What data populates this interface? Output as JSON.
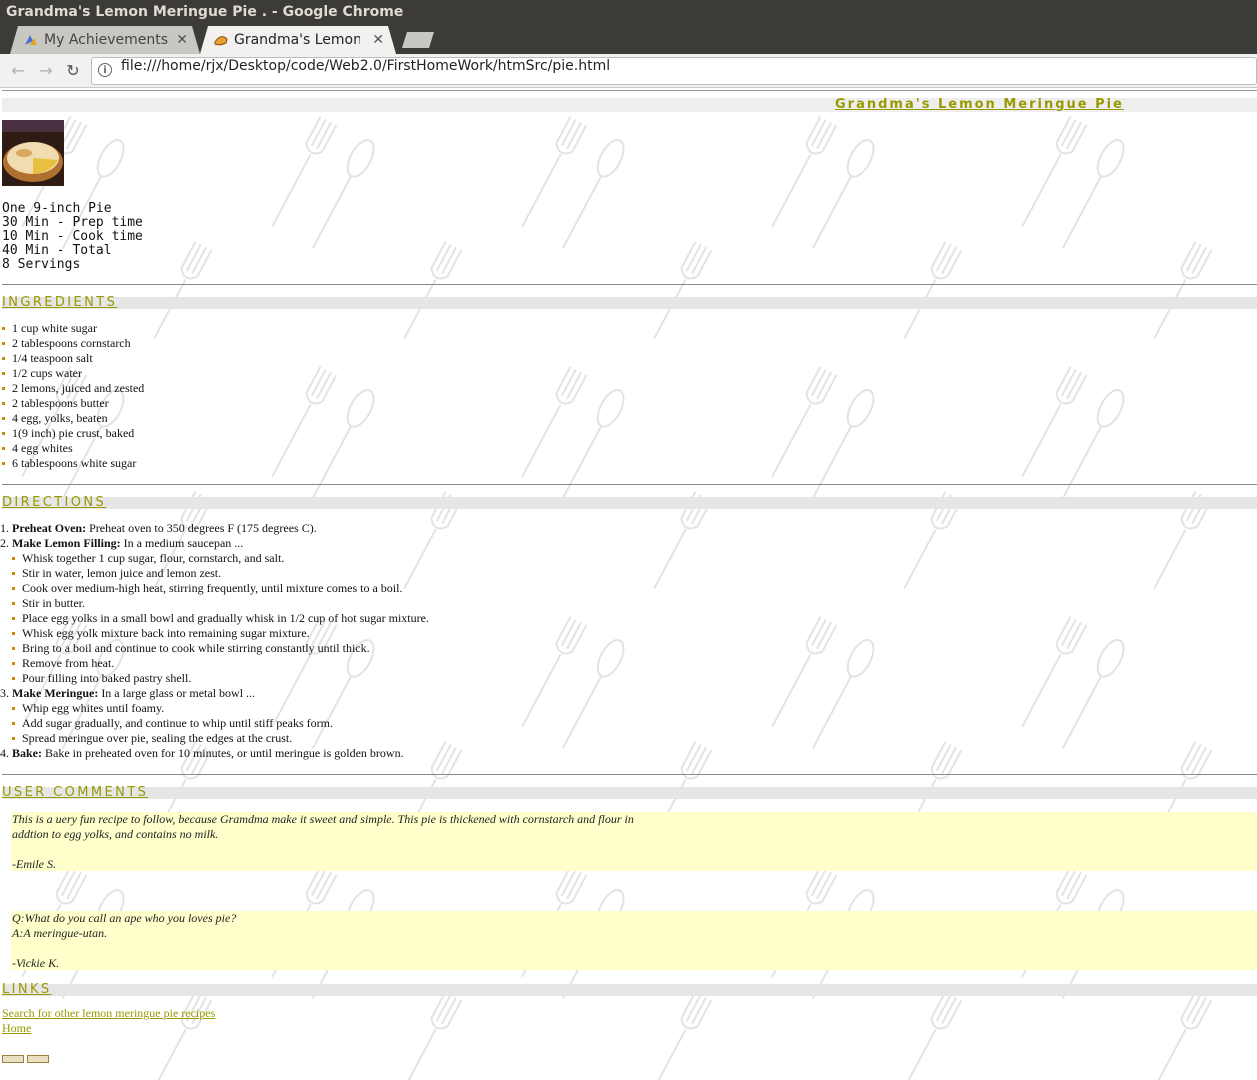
{
  "window": {
    "title": "Grandma's Lemon Meringue Pie . - Google Chrome"
  },
  "tabs": [
    {
      "label": "My Achievements",
      "close": "✕"
    },
    {
      "label": "Grandma's Lemon M",
      "close": "✕"
    }
  ],
  "toolbar": {
    "back": "←",
    "forward": "→",
    "reload": "↻",
    "info": "i",
    "url": "file:///home/rjx/Desktop/code/Web2.0/FirstHomeWork/htmSrc/pie.html"
  },
  "recipe": {
    "title": "Grandma's Lemon Meringue Pie",
    "info_lines": [
      "One 9-inch Pie",
      "30 Min - Prep time",
      "10 Min - Cook time",
      "40 Min - Total",
      "8 Servings"
    ]
  },
  "ingredients": {
    "heading": "INGREDIENTS",
    "items": [
      "1 cup white sugar",
      "2 tablespoons cornstarch",
      "1/4 teaspoon salt",
      "1/2 cups water",
      "2 lemons, juiced and zested",
      "2 tablespoons butter",
      "4 egg, yolks, beaten",
      "1(9 inch) pie crust, baked",
      "4 egg whites",
      "6 tablespoons white sugar"
    ]
  },
  "directions": {
    "heading": "DIRECTIONS",
    "steps": [
      {
        "num": "1.",
        "title": "Preheat Oven:",
        "text": " Preheat oven to 350 degrees F (175 degrees C).",
        "substeps": []
      },
      {
        "num": "2.",
        "title": "Make Lemon Filling:",
        "text": " In a medium saucepan ...",
        "substeps": [
          "Whisk together 1 cup sugar, flour, cornstarch, and salt.",
          "Stir in water, lemon juice and lemon zest.",
          "Cook over medium-high heat, stirring frequently, until mixture comes to a boil.",
          "Stir in butter.",
          "Place egg yolks in a small bowl and gradually whisk in 1/2 cup of hot sugar mixture.",
          "Whisk egg yolk mixture back into remaining sugar mixture.",
          "Bring to a boil and continue to cook while stirring constantly until thick.",
          "Remove from heat.",
          "Pour filling into baked pastry shell."
        ]
      },
      {
        "num": "3.",
        "title": "Make Meringue:",
        "text": " In a large glass or metal bowl ...",
        "substeps": [
          "Whip egg whites until foamy.",
          "Add sugar gradually, and continue to whip until stiff peaks form.",
          "Spread meringue over pie, sealing the edges at the crust."
        ]
      },
      {
        "num": "4.",
        "title": "Bake:",
        "text": " Bake in preheated oven for 10 minutes, or until meringue is golden brown.",
        "substeps": []
      }
    ]
  },
  "comments": {
    "heading": "USER COMMENTS",
    "items": [
      {
        "line1": "This is a uery fun recipe to follow, because Gramdma make it sweet and simple. This pie is thickened with cornstarch and flour in",
        "line2": "addtion to egg yolks, and contains no milk.",
        "author": "-Emile S."
      },
      {
        "line1": "Q:What do you call an ape who you loves pie?",
        "line2": "A:A meringue-utan.",
        "author": "-Vickie K."
      }
    ]
  },
  "links": {
    "heading": "LINKS",
    "search": "Search for other lemon meringue pie recipes",
    "home": "Home"
  },
  "colors": {
    "accent": "#999900",
    "comment_bg": "#ffffcc",
    "band": "#e6e6e6"
  }
}
